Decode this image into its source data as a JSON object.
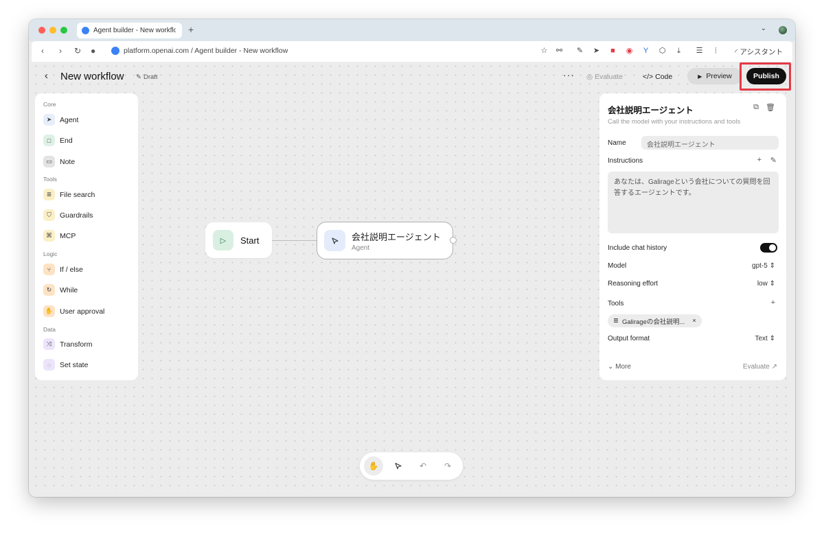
{
  "browser": {
    "tab_title": "Agent builder - New workflow",
    "url": "platform.openai.com / Agent builder - New workflow",
    "assistant_label": "アシスタント"
  },
  "header": {
    "back": "‹",
    "title": "New workflow",
    "draft": "Draft",
    "more": "···",
    "evaluate": "Evaluate",
    "code": "Code",
    "preview": "Preview",
    "publish": "Publish"
  },
  "sidebar": {
    "sections": {
      "core": "Core",
      "tools": "Tools",
      "logic": "Logic",
      "data": "Data"
    },
    "items": [
      {
        "label": "Agent",
        "icon": "cursor-icon",
        "color": "#e6edfb"
      },
      {
        "label": "End",
        "icon": "square-icon",
        "color": "#dff1e6"
      },
      {
        "label": "Note",
        "icon": "note-icon",
        "color": "#e3e3e3"
      },
      {
        "label": "File search",
        "icon": "database-icon",
        "color": "#fbefc6"
      },
      {
        "label": "Guardrails",
        "icon": "shield-icon",
        "color": "#fbefc6"
      },
      {
        "label": "MCP",
        "icon": "mcp-icon",
        "color": "#fbefc6"
      },
      {
        "label": "If / else",
        "icon": "branch-icon",
        "color": "#fde3c4"
      },
      {
        "label": "While",
        "icon": "loop-icon",
        "color": "#fde3c4"
      },
      {
        "label": "User approval",
        "icon": "approval-icon",
        "color": "#fde3c4"
      },
      {
        "label": "Transform",
        "icon": "shuffle-icon",
        "color": "#ece4fb"
      },
      {
        "label": "Set state",
        "icon": "state-icon",
        "color": "#ece4fb"
      }
    ]
  },
  "canvas": {
    "start_label": "Start",
    "agent_title": "会社説明エージェント",
    "agent_subtitle": "Agent"
  },
  "inspector": {
    "title": "会社説明エージェント",
    "subtitle": "Call the model with your instructions and tools",
    "name_label": "Name",
    "name_value": "会社説明エージェント",
    "instructions_label": "Instructions",
    "instructions_value": "あなたは、Galirageという会社についての質問を回答するエージェントです。",
    "chat_history_label": "Include chat history",
    "chat_history_on": true,
    "model_label": "Model",
    "model_value": "gpt-5",
    "reasoning_label": "Reasoning effort",
    "reasoning_value": "low",
    "tools_label": "Tools",
    "tool_chip": "Galirageの会社説明...",
    "output_label": "Output format",
    "output_value": "Text",
    "more": "More",
    "evaluate": "Evaluate"
  }
}
